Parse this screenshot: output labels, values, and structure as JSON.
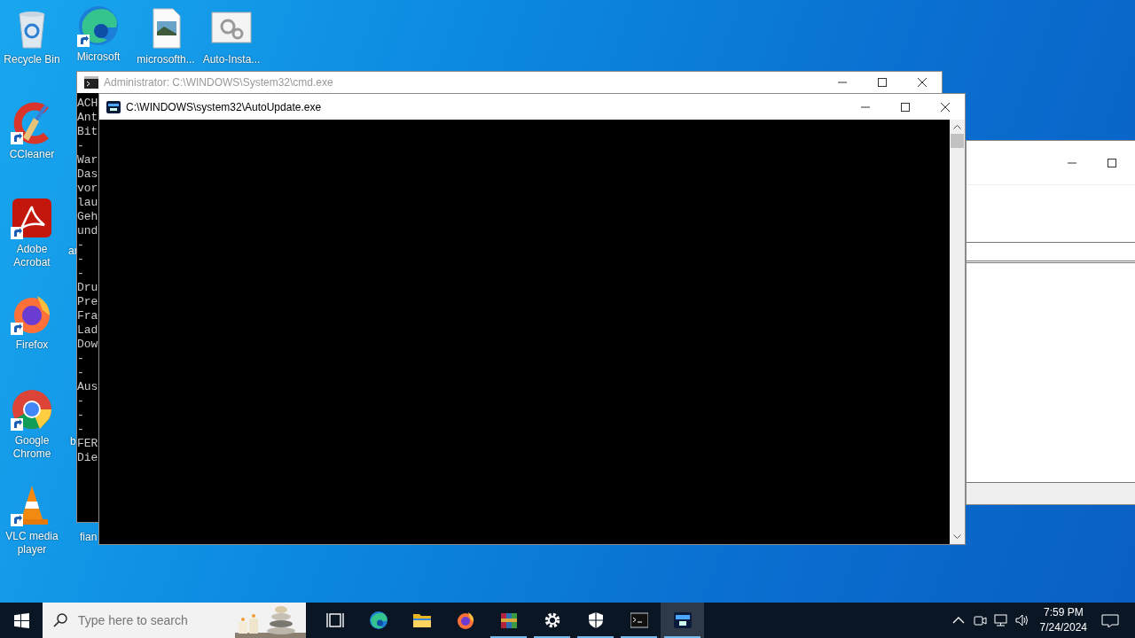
{
  "desktop_icons": [
    {
      "label": "Recycle Bin",
      "kind": "recycle-bin",
      "shortcut": false
    },
    {
      "label": "Microsoft",
      "kind": "edge",
      "shortcut": true
    },
    {
      "label": "microsofth...",
      "kind": "image-file",
      "shortcut": false
    },
    {
      "label": "Auto-Insta...",
      "kind": "settings-file",
      "shortcut": false
    },
    {
      "label": "CCleaner",
      "kind": "ccleaner",
      "shortcut": true
    },
    {
      "label": "Adobe Acrobat",
      "kind": "acrobat",
      "shortcut": true
    },
    {
      "label": "Firefox",
      "kind": "firefox",
      "shortcut": true
    },
    {
      "label": "Google Chrome",
      "kind": "chrome",
      "shortcut": true
    },
    {
      "label": "VLC media player",
      "kind": "vlc",
      "shortcut": true
    }
  ],
  "covered_icon_labels": [
    "ar",
    "b",
    "fian"
  ],
  "windows": [
    {
      "title": "Administrator: C:\\WINDOWS\\System32\\cmd.exe",
      "kind": "cmd",
      "active": false,
      "lines": [
        "ACH",
        "Ant",
        "Bit",
        "-",
        "War",
        "Das",
        "vor",
        "lau",
        "Geh",
        "und",
        "-",
        "-",
        "-",
        "Dru",
        "Pre",
        "Fra",
        "Lad",
        "Dow",
        "-",
        "-",
        "Aus",
        "-",
        "-",
        "-",
        "FER",
        "Die"
      ]
    },
    {
      "title": "C:\\WINDOWS\\system32\\AutoUpdate.exe",
      "kind": "console",
      "active": true
    },
    {
      "kind": "blank",
      "active": false
    }
  ],
  "taskbar": {
    "search": {
      "placeholder": "Type here to search"
    },
    "apps": [
      {
        "kind": "taskview",
        "running": false,
        "selected": false
      },
      {
        "kind": "edge",
        "running": false,
        "selected": false
      },
      {
        "kind": "explorer",
        "running": false,
        "selected": false
      },
      {
        "kind": "firefox",
        "running": false,
        "selected": false
      },
      {
        "kind": "winrar",
        "running": true,
        "selected": false
      },
      {
        "kind": "settings",
        "running": true,
        "selected": false
      },
      {
        "kind": "security",
        "running": true,
        "selected": false
      },
      {
        "kind": "cmd",
        "running": true,
        "selected": false
      },
      {
        "kind": "autoupdate",
        "running": true,
        "selected": true
      }
    ],
    "tray": {
      "time": "7:59 PM",
      "date": "7/24/2024"
    }
  }
}
